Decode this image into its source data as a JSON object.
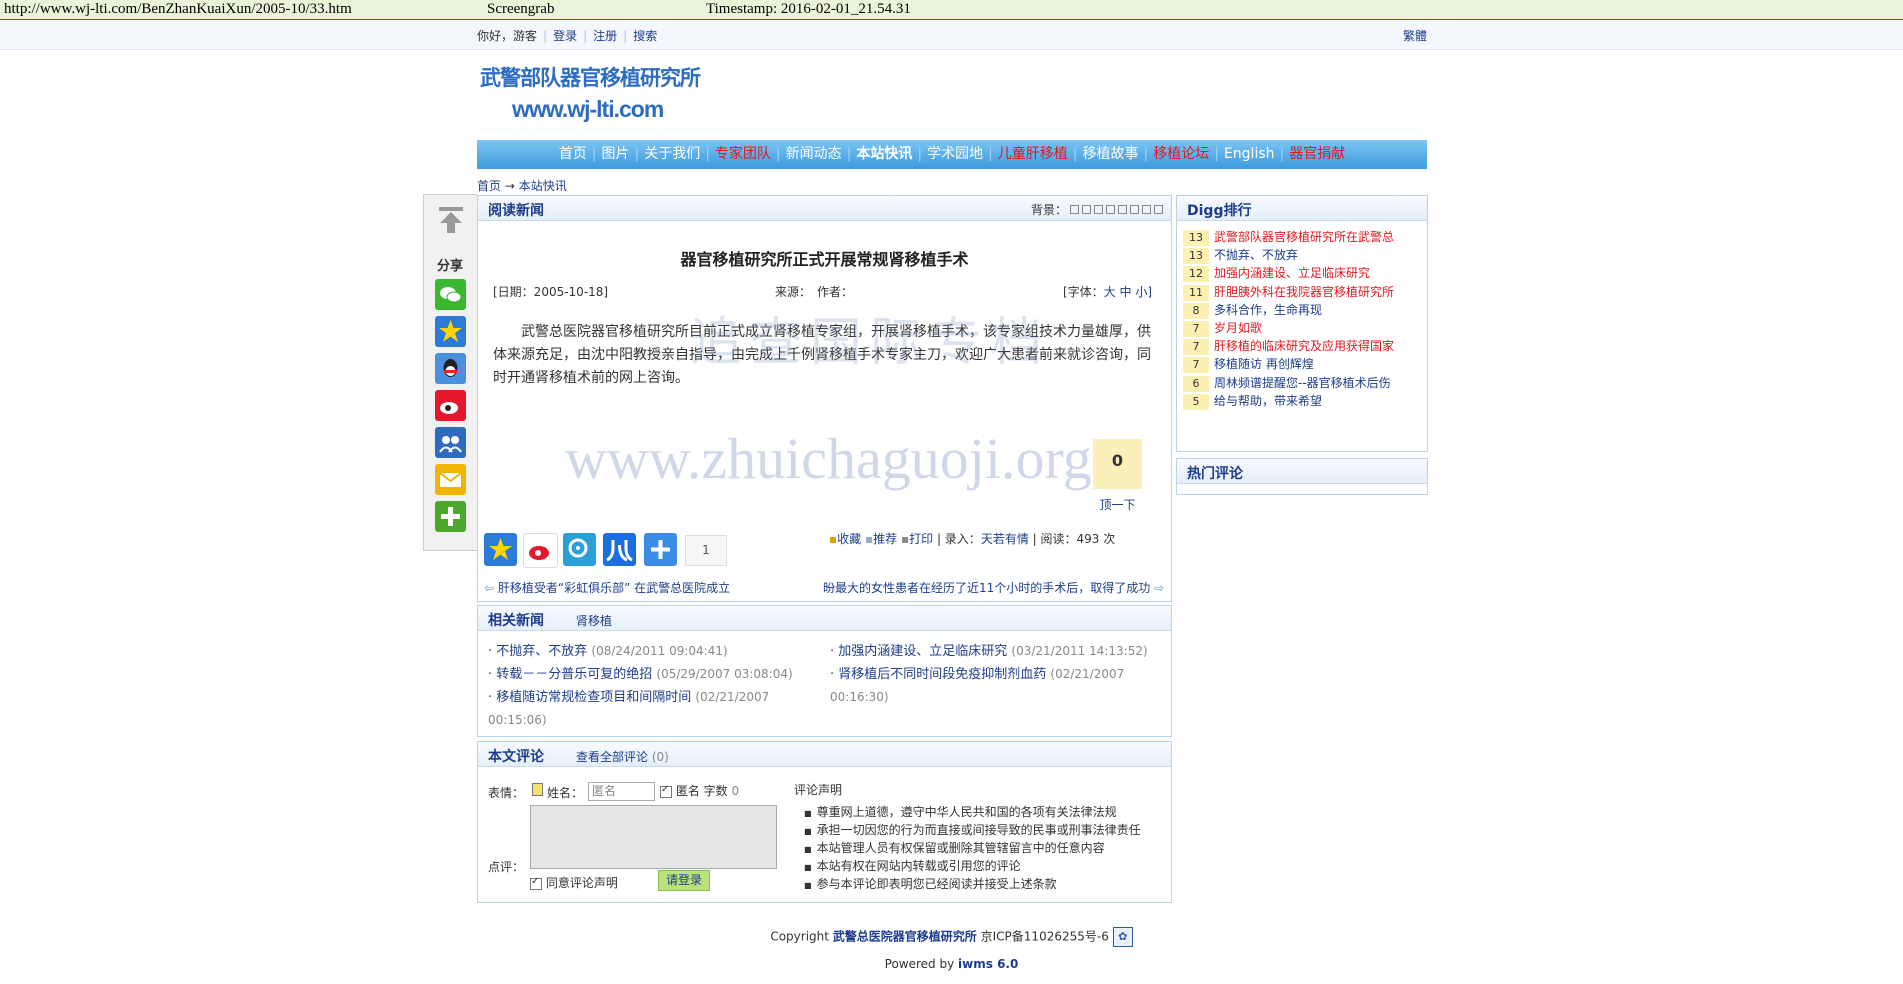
{
  "archive": {
    "url": "http://www.wj-lti.com/BenZhanKuaiXun/2005-10/33.htm",
    "label": "Screengrab",
    "timestamp": "Timestamp: 2016-02-01_21.54.31"
  },
  "topbar": {
    "greeting": "你好，游客",
    "login": "登录",
    "register": "注册",
    "search": "搜索",
    "traditional": "繁體"
  },
  "logo": {
    "line1": "武警部队器官移植研究所",
    "line2": "www.wj-lti.com"
  },
  "nav": [
    {
      "label": "首页",
      "style": "white"
    },
    {
      "label": "图片",
      "style": "white"
    },
    {
      "label": "关于我们",
      "style": "white"
    },
    {
      "label": "专家团队",
      "style": "red"
    },
    {
      "label": "新闻动态",
      "style": "white"
    },
    {
      "label": "本站快讯",
      "style": "bold"
    },
    {
      "label": "学术园地",
      "style": "white"
    },
    {
      "label": "儿童肝移植",
      "style": "red"
    },
    {
      "label": "移植故事",
      "style": "white"
    },
    {
      "label": "移植论坛",
      "style": "red"
    },
    {
      "label": "English",
      "style": "white"
    },
    {
      "label": "器官捐献",
      "style": "red"
    }
  ],
  "breadcrumb": {
    "home": "首页",
    "arrow": "→",
    "current": "本站快讯"
  },
  "share_panel": {
    "label": "分享"
  },
  "article": {
    "box_title": "阅读新闻",
    "bg_label": "背景：",
    "title": "器官移植研究所正式开展常规肾移植手术",
    "date": "[日期：2005-10-18]",
    "source": "来源：",
    "author": "作者：",
    "font_label": "[字体：",
    "font_big": "大",
    "font_mid": "中",
    "font_small": "小]",
    "body": "武警总医院器官移植研究所目前正式成立肾移植专家组，开展肾移植手术，该专家组技术力量雄厚，供体来源充足，由沈中阳教授亲自指导，由完成上千例肾移植手术专家主刀，欢迎广大患者前来就诊咨询，同时开通肾移植术前的网上咨询。",
    "digg_count": "0",
    "digg_button": "顶一下",
    "share_count": "1",
    "tool_fav": "收藏",
    "tool_rec": "推荐",
    "tool_print": "打印",
    "entry_label": "| 录入：",
    "entry_user": "天若有情",
    "reads": "| 阅读：493 次",
    "prev": "肝移植受者“彩虹俱乐部” 在武警总医院成立",
    "next": "昐最大的女性患者在经历了近11个小时的手术后，取得了成功"
  },
  "related": {
    "title": "相关新闻",
    "tag": "肾移植",
    "left": [
      {
        "title": "不抛弃、不放弃",
        "date": "(08/24/2011 09:04:41)"
      },
      {
        "title": "转载－－分普乐可复的绝招",
        "date": "(05/29/2007 03:08:04)"
      },
      {
        "title": "移植随访常规检查项目和间隔时间",
        "date": "(02/21/2007 00:15:06)"
      }
    ],
    "right": [
      {
        "title": "加强内涵建设、立足临床研究",
        "date": "(03/21/2011 14:13:52)"
      },
      {
        "title": "肾移植后不同时间段免疫抑制剂血药",
        "date": "(02/21/2007 00:16:30)"
      }
    ]
  },
  "comments": {
    "title": "本文评论",
    "view_all": "查看全部评论",
    "count": "(0)",
    "emotion": "表情：",
    "name_label": "姓名：",
    "name_placeholder": "匿名",
    "anon": "匿名",
    "chars": "字数",
    "chars_count": "0",
    "review": "点评：",
    "agree": "同意评论声明",
    "login_btn": "请登录",
    "decl_title": "评论声明",
    "decl_items": [
      "尊重网上道德，遵守中华人民共和国的各项有关法律法规",
      "承担一切因您的行为而直接或间接导致的民事或刑事法律责任",
      "本站管理人员有权保留或删除其管辖留言中的任意内容",
      "本站有权在网站内转载或引用您的评论",
      "参与本评论即表明您已经阅读并接受上述条款"
    ]
  },
  "digg_rank": {
    "title": "Digg排行",
    "items": [
      {
        "n": "13",
        "text": "武警部队器官移植研究所在武警总",
        "red": true
      },
      {
        "n": "13",
        "text": "不抛弃、不放弃",
        "red": false
      },
      {
        "n": "12",
        "text": "加强内涵建设、立足临床研究",
        "red": true
      },
      {
        "n": "11",
        "text": "肝胆胰外科在我院器官移植研究所",
        "red": true
      },
      {
        "n": "8",
        "text": "多科合作，生命再现",
        "red": false
      },
      {
        "n": "7",
        "text": "岁月如歌",
        "red": true
      },
      {
        "n": "7",
        "text": "肝移植的临床研究及应用获得国家",
        "red": true
      },
      {
        "n": "7",
        "text": "移植随访 再创辉煌",
        "red": false
      },
      {
        "n": "6",
        "text": "周林频谱提醒您--器官移植术后伤",
        "red": false
      },
      {
        "n": "5",
        "text": "给与帮助，带来希望",
        "red": false
      }
    ]
  },
  "hot_comments": {
    "title": "热门评论"
  },
  "footer": {
    "copyright": "Copyright",
    "org": "武警总医院器官移植研究所",
    "icp": "京ICP备11026255号-6",
    "powered": "Powered by",
    "engine": "iwms 6.0"
  },
  "watermark": {
    "cn": "追查国际专档",
    "url": "www.zhuichaguoji.org"
  },
  "colors": {
    "accent": "#1d3d8c",
    "red": "#e1181e",
    "nav_top": "#7cc4f2",
    "nav_bottom": "#3d9be0"
  }
}
